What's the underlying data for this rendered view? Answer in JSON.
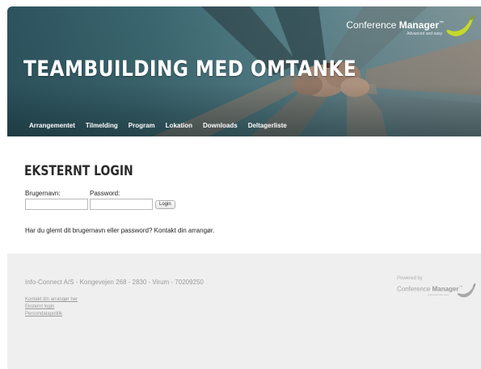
{
  "header": {
    "title": "TEAMBUILDING MED OMTANKE",
    "brand": {
      "name_light": "Conference ",
      "name_bold": "Manager",
      "trademark": "™",
      "tagline": "Advanced and easy"
    },
    "nav": [
      {
        "label": "Arrangementet"
      },
      {
        "label": "Tilmelding"
      },
      {
        "label": "Program"
      },
      {
        "label": "Lokation"
      },
      {
        "label": "Downloads"
      },
      {
        "label": "Deltagerliste"
      }
    ]
  },
  "login": {
    "title": "EKSTERNT LOGIN",
    "username_label": "Brugernavn:",
    "username_value": "",
    "password_label": "Password:",
    "password_value": "",
    "button_label": "Login",
    "forgot_text": "Har du glemt dit brugernavn eller password? Kontakt din arrangør."
  },
  "footer": {
    "company_line": "Info-Connect A/S - Kongevejen 268 - 2830 - Virum - 70209250",
    "links": [
      {
        "label": "Kontakt din arrangør her"
      },
      {
        "label": "Eksternt login"
      },
      {
        "label": "Persondatapolitik"
      }
    ],
    "powered_by": "Powered by",
    "brand_light": "Conference ",
    "brand_bold": "Manager",
    "brand_trademark": "™",
    "brand_tagline": "Advanced and easy"
  },
  "colors": {
    "banner_teal": "#3e6a73",
    "accent_lime": "#c5d92a",
    "footer_bg": "#efefef",
    "footer_text": "#9a9a9a"
  },
  "icons": {
    "brand_logo": "banana-swoosh-icon"
  }
}
